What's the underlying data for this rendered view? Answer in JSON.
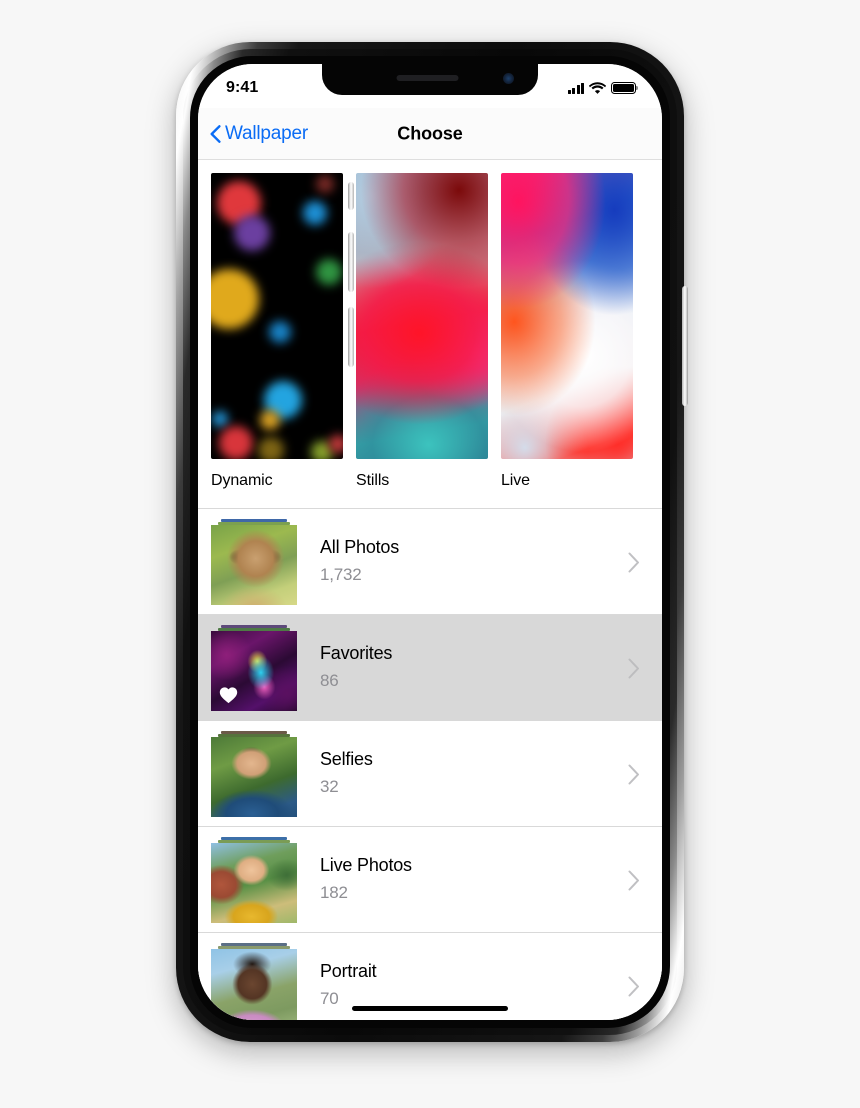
{
  "status_bar": {
    "time": "9:41",
    "signal_icon": "cellular-signal-icon",
    "signal_bars": 4,
    "wifi_icon": "wifi-icon",
    "battery_icon": "battery-icon"
  },
  "nav_bar": {
    "back_label": "Wallpaper",
    "back_icon": "chevron-left-icon",
    "title": "Choose"
  },
  "wallpaper_types": [
    {
      "label": "Dynamic",
      "thumb": "dynamic-wallpaper-thumbnail"
    },
    {
      "label": "Stills",
      "thumb": "stills-wallpaper-thumbnail"
    },
    {
      "label": "Live",
      "thumb": "live-wallpaper-thumbnail"
    }
  ],
  "albums": [
    {
      "title": "All Photos",
      "count": "1,732",
      "selected": false,
      "badge": null
    },
    {
      "title": "Favorites",
      "count": "86",
      "selected": true,
      "badge": "heart-icon"
    },
    {
      "title": "Selfies",
      "count": "32",
      "selected": false,
      "badge": null
    },
    {
      "title": "Live Photos",
      "count": "182",
      "selected": false,
      "badge": null
    },
    {
      "title": "Portrait",
      "count": "70",
      "selected": false,
      "badge": null
    }
  ],
  "home_indicator": "home-indicator",
  "colors": {
    "accent_blue": "#0a6cf5",
    "secondary_text": "#8e8e93",
    "selected_row_bg": "#d8d8d8",
    "separator": "#d9d9d9",
    "navbar_bg": "#fbfbfb",
    "page_bg": "#f7f7f7"
  }
}
